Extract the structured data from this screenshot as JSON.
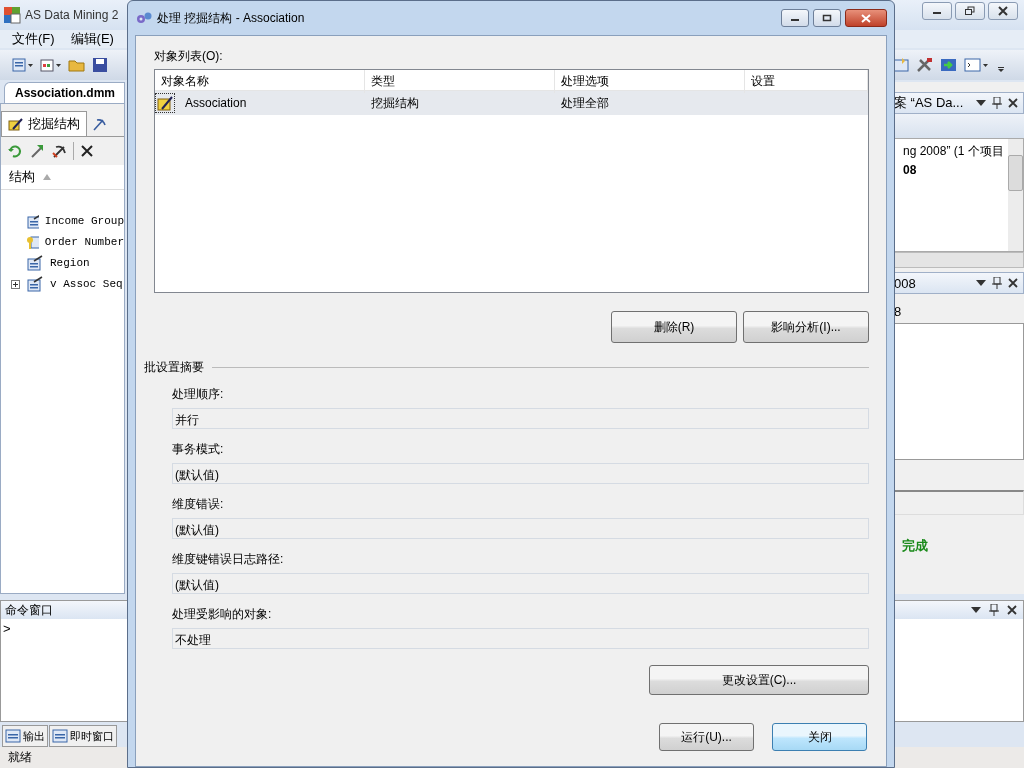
{
  "ide": {
    "title": "AS Data Mining 2",
    "menu": [
      "文件(F)",
      "编辑(E)"
    ],
    "document_tab": "Association.dmm",
    "designer_tab": "挖掘结构",
    "tree_header": "结构",
    "tree": [
      {
        "label": "Income Group",
        "kind": "column"
      },
      {
        "label": "Order Number",
        "kind": "key"
      },
      {
        "label": "Region",
        "kind": "column"
      },
      {
        "label": "v Assoc Seq",
        "kind": "table"
      }
    ],
    "solution_panel": {
      "title": "案 “AS Da...",
      "lines": [
        "ng 2008” (1 个项目",
        "08"
      ]
    },
    "properties_panel": {
      "title": "008",
      "value": "8",
      "status": "完成"
    },
    "command_window": {
      "title": "命令窗口",
      "prompt": ">"
    },
    "bottom_tabs": [
      "输出",
      "即时窗口"
    ],
    "status_bar": "就绪"
  },
  "dialog": {
    "title": "处理 挖掘结构 - Association",
    "list_label": "对象列表(O):",
    "columns": [
      "对象名称",
      "类型",
      "处理选项",
      "设置"
    ],
    "rows": [
      {
        "cells": [
          "Association",
          "挖掘结构",
          "处理全部",
          ""
        ],
        "selected": true
      }
    ],
    "list_buttons": [
      "删除(R)",
      "影响分析(I)..."
    ],
    "summary_title": "批设置摘要",
    "settings": [
      {
        "label": "处理顺序:",
        "value": "并行"
      },
      {
        "label": "事务模式:",
        "value": "(默认值)"
      },
      {
        "label": "维度错误:",
        "value": "(默认值)"
      },
      {
        "label": "维度键错误日志路径:",
        "value": "(默认值)"
      },
      {
        "label": "处理受影响的对象:",
        "value": "不处理"
      }
    ],
    "change_button": "更改设置(C)...",
    "buttons": [
      {
        "label": "运行(U)...",
        "default": false
      },
      {
        "label": "关闭",
        "default": true
      }
    ]
  }
}
